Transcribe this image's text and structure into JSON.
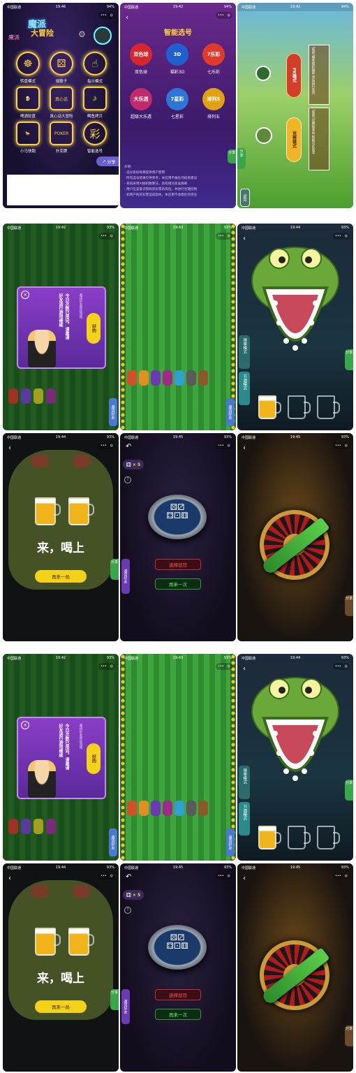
{
  "status": {
    "carrier": "中国联通",
    "time_home": "19:46",
    "time_lottery": "19:42",
    "time_pk": "19:43",
    "time_b1": "19:42",
    "time_b2": "19:43",
    "time_b3": "19:44",
    "time_c1": "19:44",
    "time_c2": "19:45",
    "time_c3": "19:45",
    "battery_a": "94%",
    "battery_b": "93%"
  },
  "capsule": {
    "dots": "•••",
    "target": "◎"
  },
  "home": {
    "logo_line1": "魔派",
    "logo_line2": "大冒险",
    "logo_sub": "魔派",
    "items": [
      {
        "label": "转盘模式",
        "icon": "wheel-icon",
        "glyph": "☸"
      },
      {
        "label": "摇骰子",
        "icon": "dice-icon",
        "glyph": "⚄"
      },
      {
        "label": "指示模式",
        "icon": "pointer-icon",
        "glyph": "☝"
      },
      {
        "label": "啤酒轮盘",
        "icon": "beer-wheel-icon",
        "glyph": "🍺"
      },
      {
        "label": "真心话大冒险",
        "icon": "truth-dare-icon",
        "glyph": "真心话"
      },
      {
        "label": "鳄鱼拷贝",
        "icon": "crocodile-icon",
        "glyph": "🐊"
      },
      {
        "label": "小马快跑",
        "icon": "horse-icon",
        "glyph": "🐎"
      },
      {
        "label": "扑克牌",
        "icon": "poker-icon",
        "glyph": "POKER"
      },
      {
        "label": "智能选号",
        "icon": "lottery-icon",
        "glyph": "彩"
      }
    ],
    "share": "分享"
  },
  "lottery": {
    "title": "智能选号",
    "items": [
      {
        "label": "双色球",
        "color": "#d8262e",
        "badge": "双色球"
      },
      {
        "label": "福彩3D",
        "color": "#1f5fd0",
        "badge": "3D"
      },
      {
        "label": "七乐彩",
        "color": "#e23a2a",
        "badge": "7乐彩"
      },
      {
        "label": "超级大乐透",
        "color": "#c02b6b",
        "badge": "大乐透"
      },
      {
        "label": "七星彩",
        "color": "#2b76d6",
        "badge": "7星彩"
      },
      {
        "label": "排列五",
        "color": "#e2a013",
        "badge": "排列5"
      }
    ],
    "notice_title": "声明:",
    "notice": [
      "- 选号系统免费提供用户使用",
      "- 所有选号结果仅供参考，本应用不做任何投资建议",
      "- 系统采用AI随机数算法，具有相对高准确率",
      "- 用户应该意识到购买彩票的风险，并进行合理控制",
      "- 如用户购买彩票造成损失，本应用不承担任何责任"
    ],
    "share": "分享"
  },
  "pk": {
    "pk_mode": "PK模式",
    "race_mode": "竞赛模式",
    "rules_a": "[规则]输者随机抽取 然后执行惩罚 ",
    "rules_b": "[规则]比赛结束后 根据马匹名次 ",
    "back": "返回"
  },
  "race_popup": {
    "text": "今日次数已用完，请邀请好友进行游戏继续",
    "sub": "邀请好友继续游戏",
    "ok": "好的",
    "side": "邀请好友"
  },
  "croc": {
    "side_top": "猜拳模式",
    "side_bottom": "节酒模式",
    "share": "分享"
  },
  "drink": {
    "title": "来，喝上",
    "again": "再来一局",
    "share": "分享"
  },
  "dice": {
    "count": "× 5",
    "help": "?",
    "punish": "选择惩罚",
    "again": "再来一次",
    "invite": "邀请好友"
  },
  "roulette": {
    "share": "分享"
  }
}
